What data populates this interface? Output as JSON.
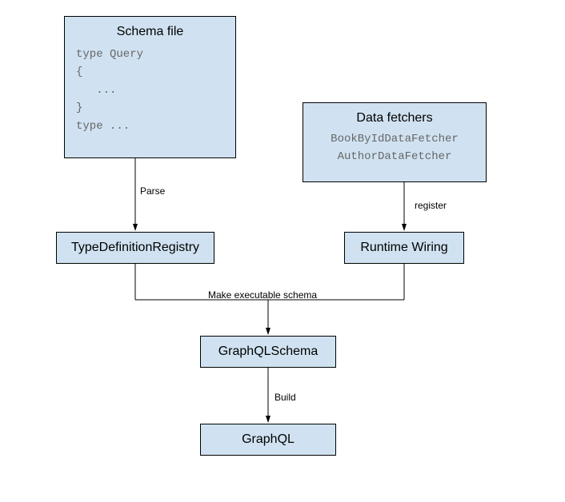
{
  "boxes": {
    "schemaFile": {
      "title": "Schema file",
      "code": "type Query\n{\n   ...\n}\ntype ..."
    },
    "dataFetchers": {
      "title": "Data fetchers",
      "code": "BookByIdDataFetcher\nAuthorDataFetcher"
    },
    "typeDefRegistry": {
      "label": "TypeDefinitionRegistry"
    },
    "runtimeWiring": {
      "label": "Runtime Wiring"
    },
    "graphqlSchema": {
      "label": "GraphQLSchema"
    },
    "graphql": {
      "label": "GraphQL"
    }
  },
  "edges": {
    "parse": "Parse",
    "register": "register",
    "makeExecutable": "Make executable schema",
    "build": "Build"
  },
  "chart_data": {
    "type": "diagram",
    "nodes": [
      {
        "id": "schemaFile",
        "label": "Schema file",
        "detail": "type Query { ... } type ..."
      },
      {
        "id": "dataFetchers",
        "label": "Data fetchers",
        "detail": "BookByIdDataFetcher, AuthorDataFetcher"
      },
      {
        "id": "typeDefRegistry",
        "label": "TypeDefinitionRegistry"
      },
      {
        "id": "runtimeWiring",
        "label": "Runtime Wiring"
      },
      {
        "id": "graphqlSchema",
        "label": "GraphQLSchema"
      },
      {
        "id": "graphql",
        "label": "GraphQL"
      }
    ],
    "edges": [
      {
        "from": "schemaFile",
        "to": "typeDefRegistry",
        "label": "Parse"
      },
      {
        "from": "dataFetchers",
        "to": "runtimeWiring",
        "label": "register"
      },
      {
        "from": "typeDefRegistry",
        "to": "graphqlSchema",
        "label": "Make executable schema"
      },
      {
        "from": "runtimeWiring",
        "to": "graphqlSchema",
        "label": "Make executable schema"
      },
      {
        "from": "graphqlSchema",
        "to": "graphql",
        "label": "Build"
      }
    ]
  }
}
